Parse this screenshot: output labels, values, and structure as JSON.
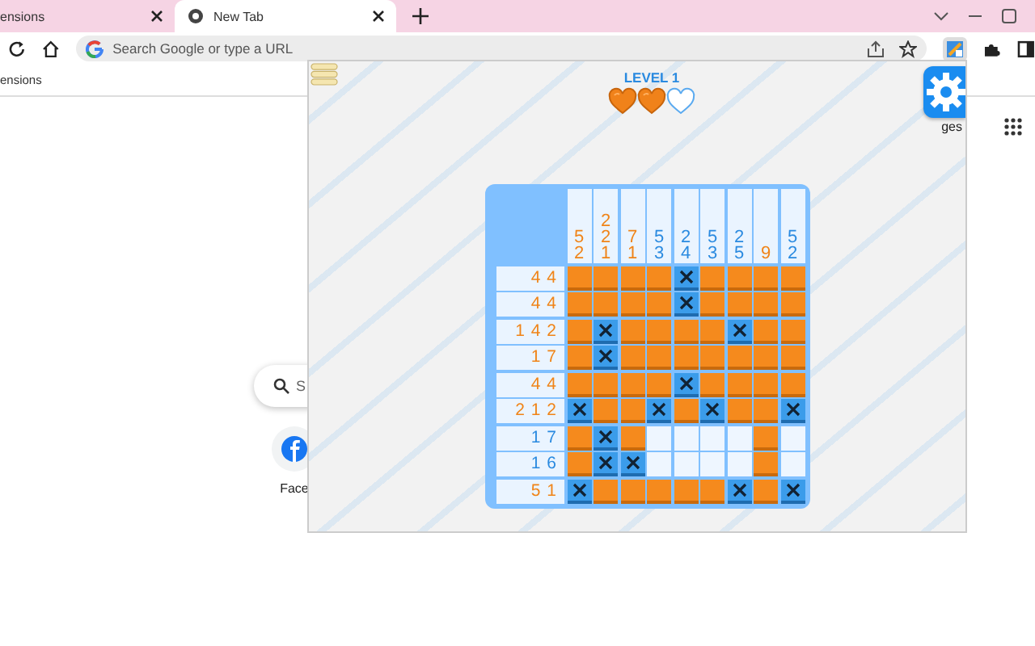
{
  "tabs": [
    {
      "label": "ensions",
      "selected": false
    },
    {
      "label": "New Tab",
      "selected": true
    }
  ],
  "omnibox": {
    "placeholder": "Search Google or type a URL"
  },
  "bookmarks_bar": {
    "item": "ensions"
  },
  "new_tab_page": {
    "images_link": "ges",
    "search_box": {
      "placeholder": "S"
    },
    "shortcut": {
      "label": "Face"
    }
  },
  "popup": {
    "level": "LEVEL 1",
    "hearts": [
      {
        "filled": true
      },
      {
        "filled": true
      },
      {
        "filled": false
      }
    ],
    "column_clues": [
      {
        "text": "5 2",
        "solved": true
      },
      {
        "text": "2 2 1",
        "solved": true
      },
      {
        "text": "7 1",
        "solved": true
      },
      {
        "text": "5 3",
        "solved": false
      },
      {
        "text": "2 4",
        "solved": false
      },
      {
        "text": "5 3",
        "solved": false
      },
      {
        "text": "2 5",
        "solved": false
      },
      {
        "text": "9",
        "solved": true
      },
      {
        "text": "5 2",
        "solved": false
      }
    ],
    "rows": [
      {
        "clue": "4 4",
        "solved": true,
        "cells": [
          {
            "kind": "filled"
          },
          {
            "kind": "filled"
          },
          {
            "kind": "filled"
          },
          {
            "kind": "filled"
          },
          {
            "kind": "crossed"
          },
          {
            "kind": "filled"
          },
          {
            "kind": "filled"
          },
          {
            "kind": "filled"
          },
          {
            "kind": "filled"
          }
        ]
      },
      {
        "clue": "4 4",
        "solved": true,
        "cells": [
          {
            "kind": "filled"
          },
          {
            "kind": "filled"
          },
          {
            "kind": "filled"
          },
          {
            "kind": "filled"
          },
          {
            "kind": "crossed"
          },
          {
            "kind": "filled"
          },
          {
            "kind": "filled"
          },
          {
            "kind": "filled"
          },
          {
            "kind": "filled"
          }
        ]
      },
      {
        "clue": "1 4 2",
        "solved": true,
        "cells": [
          {
            "kind": "filled"
          },
          {
            "kind": "crossed"
          },
          {
            "kind": "filled"
          },
          {
            "kind": "filled"
          },
          {
            "kind": "filled"
          },
          {
            "kind": "filled"
          },
          {
            "kind": "crossed"
          },
          {
            "kind": "filled"
          },
          {
            "kind": "filled"
          }
        ]
      },
      {
        "clue": "1 7",
        "solved": true,
        "cells": [
          {
            "kind": "filled"
          },
          {
            "kind": "crossed"
          },
          {
            "kind": "filled"
          },
          {
            "kind": "filled"
          },
          {
            "kind": "filled"
          },
          {
            "kind": "filled"
          },
          {
            "kind": "filled"
          },
          {
            "kind": "filled"
          },
          {
            "kind": "filled"
          }
        ]
      },
      {
        "clue": "4 4",
        "solved": true,
        "cells": [
          {
            "kind": "filled"
          },
          {
            "kind": "filled"
          },
          {
            "kind": "filled"
          },
          {
            "kind": "filled"
          },
          {
            "kind": "crossed"
          },
          {
            "kind": "filled"
          },
          {
            "kind": "filled"
          },
          {
            "kind": "filled"
          },
          {
            "kind": "filled"
          }
        ]
      },
      {
        "clue": "2 1 2",
        "solved": true,
        "cells": [
          {
            "kind": "crossed"
          },
          {
            "kind": "filled"
          },
          {
            "kind": "filled"
          },
          {
            "kind": "crossed"
          },
          {
            "kind": "filled"
          },
          {
            "kind": "crossed"
          },
          {
            "kind": "filled"
          },
          {
            "kind": "filled"
          },
          {
            "kind": "crossed"
          }
        ]
      },
      {
        "clue": "1 7",
        "solved": false,
        "cells": [
          {
            "kind": "filled"
          },
          {
            "kind": "crossed"
          },
          {
            "kind": "filled"
          },
          {
            "kind": "empty"
          },
          {
            "kind": "empty"
          },
          {
            "kind": "empty"
          },
          {
            "kind": "empty"
          },
          {
            "kind": "filled"
          },
          {
            "kind": "empty"
          }
        ]
      },
      {
        "clue": "1 6",
        "solved": false,
        "cells": [
          {
            "kind": "filled"
          },
          {
            "kind": "crossed"
          },
          {
            "kind": "crossed"
          },
          {
            "kind": "empty"
          },
          {
            "kind": "empty"
          },
          {
            "kind": "empty"
          },
          {
            "kind": "empty"
          },
          {
            "kind": "filled"
          },
          {
            "kind": "empty"
          }
        ]
      },
      {
        "clue": "5 1",
        "solved": true,
        "cells": [
          {
            "kind": "crossed"
          },
          {
            "kind": "filled"
          },
          {
            "kind": "filled"
          },
          {
            "kind": "filled"
          },
          {
            "kind": "filled"
          },
          {
            "kind": "filled"
          },
          {
            "kind": "crossed"
          },
          {
            "kind": "filled"
          },
          {
            "kind": "crossed"
          }
        ]
      }
    ]
  }
}
